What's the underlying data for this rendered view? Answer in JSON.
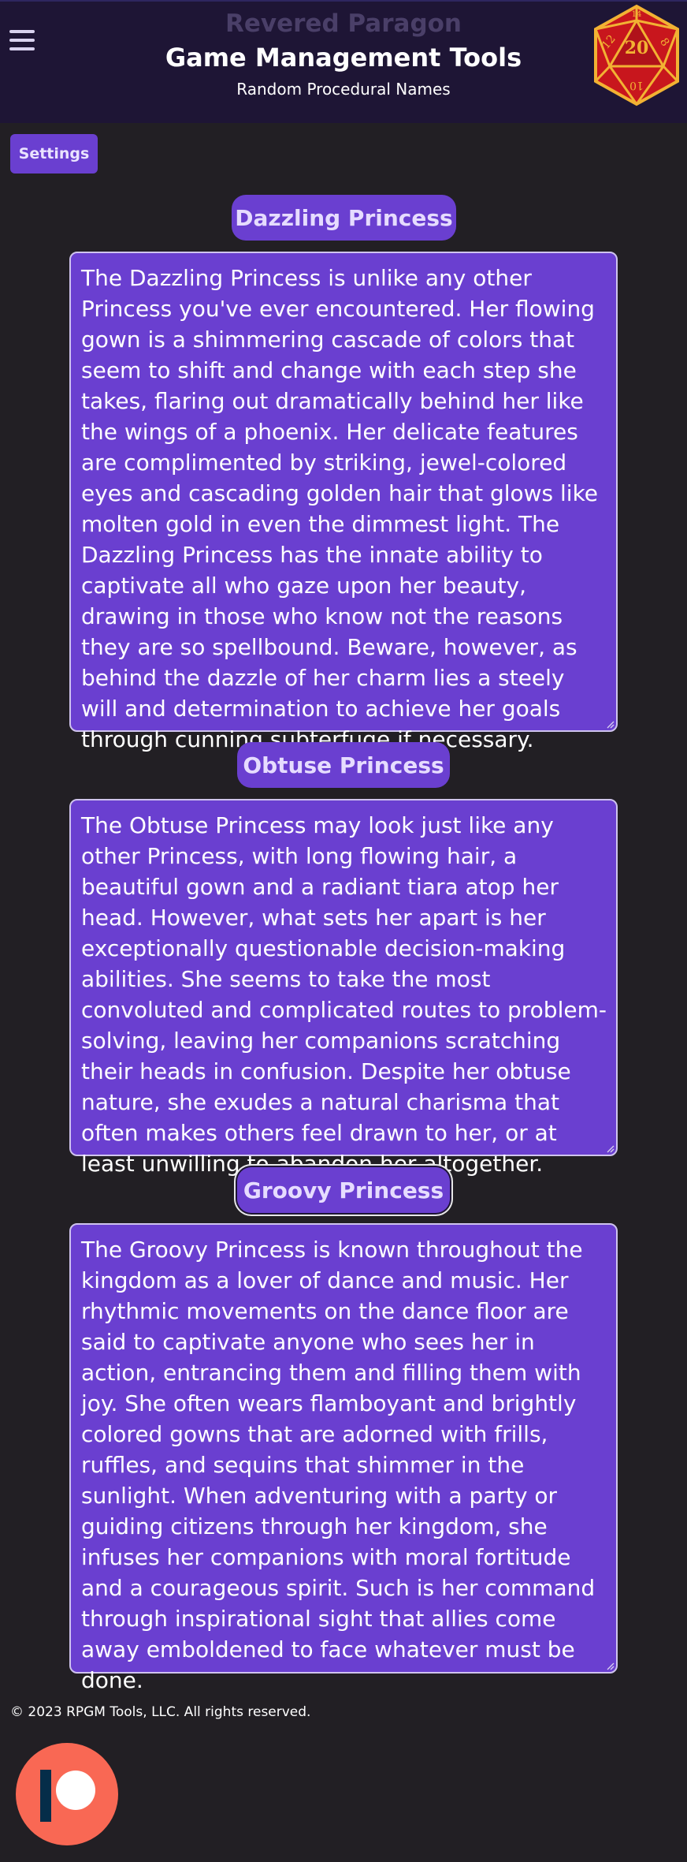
{
  "header": {
    "brand": "Revered Paragon",
    "title": "Game Management Tools",
    "subtitle": "Random Procedural Names",
    "menu_icon": "hamburger-menu-icon",
    "logo_icon": "d20-die-icon"
  },
  "toolbar": {
    "settings_label": "Settings"
  },
  "entries": [
    {
      "name": "Dazzling Princess",
      "description": "The Dazzling Princess is unlike any other Princess you've ever encountered. Her flowing gown is a shimmering cascade of colors that seem to shift and change with each step she takes, flaring out dramatically behind her like the wings of a phoenix. Her delicate features are complimented by striking, jewel-colored eyes and cascading golden hair that glows like molten gold in even the dimmest light. The Dazzling Princess has the innate ability to captivate all who gaze upon her beauty, drawing in those who know not the reasons they are so spellbound. Beware, however, as behind the dazzle of her charm lies a steely will and determination to achieve her goals through cunning subterfuge if necessary."
    },
    {
      "name": "Obtuse Princess",
      "description": "The Obtuse Princess may look just like any other Princess, with long flowing hair, a beautiful gown and a radiant tiara atop her head. However, what sets her apart is her exceptionally questionable decision-making abilities. She seems to take the most convoluted and complicated routes to problem-solving, leaving her companions scratching their heads in confusion. Despite her obtuse nature, she exudes a natural charisma that often makes others feel drawn to her, or at least unwilling to abandon her altogether."
    },
    {
      "name": "Groovy Princess",
      "description": "The Groovy Princess is known throughout the kingdom as a lover of dance and music. Her rhythmic movements on the dance floor are said to captivate anyone who sees her in action, entrancing them and filling them with joy. She often wears flamboyant and brightly colored gowns that are adorned with frills, ruffles, and sequins that shimmer in the sunlight. When adventuring with a party or guiding citizens through her kingdom, she infuses her companions with moral fortitude and a courageous spirit. Such is her command through inspirational sight that allies come away emboldened to face whatever must be done."
    }
  ],
  "footer": {
    "copyright": "© 2023 RPGM Tools, LLC. All rights reserved."
  },
  "colors": {
    "page_bg": "#221f24",
    "header_bg": "#1e1535",
    "accent": "#6a3fd0",
    "patreon": "#f96854",
    "d20_red": "#c8161d",
    "d20_gold": "#f2b233"
  }
}
